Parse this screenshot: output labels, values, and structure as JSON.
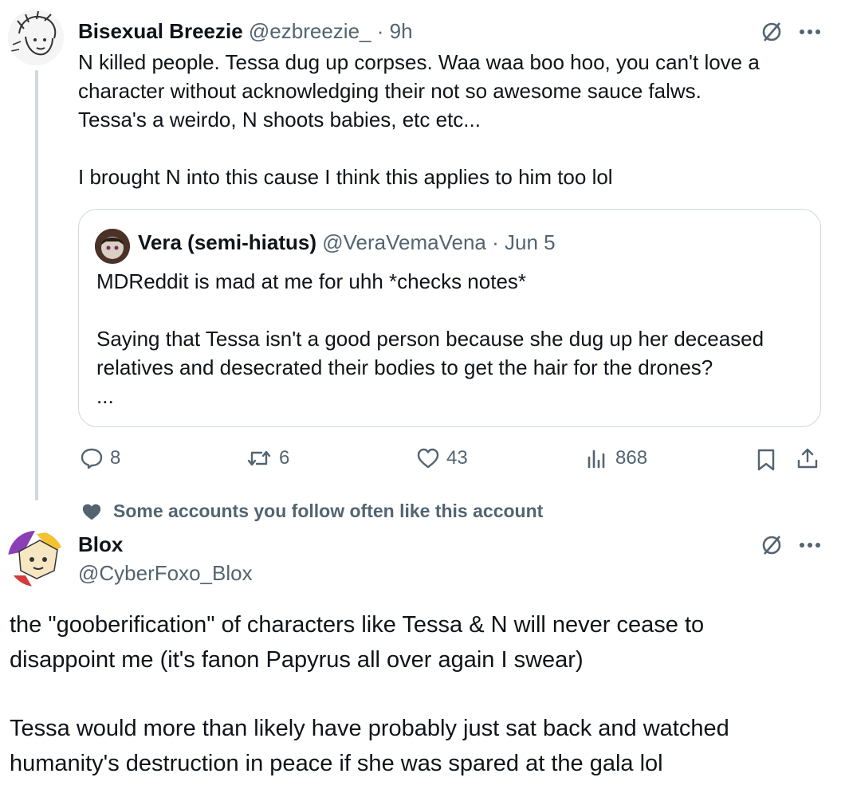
{
  "tweet1": {
    "name": "Bisexual Breezie",
    "handle": "@ezbreezie_",
    "time": "· 9h",
    "lines": [
      "N killed people. Tessa dug up corpses. Waa waa boo hoo, you can't love a",
      "character without acknowledging their not so awesome sauce falws.",
      "Tessa's a weirdo, N shoots babies, etc etc...",
      "",
      "I brought N into this cause I think this applies to him too lol"
    ],
    "quote": {
      "name": "Vera (semi-hiatus)",
      "handle": "@VeraVemaVena",
      "time": "· Jun 5",
      "lines": [
        "MDReddit is mad at me for uhh *checks notes*",
        "",
        "Saying that Tessa isn't a good person because she dug up her deceased",
        "relatives and desecrated their bodies to get the hair for the drones?",
        "..."
      ]
    },
    "actions": {
      "replies": "8",
      "reposts": "6",
      "likes": "43",
      "views": "868"
    },
    "more_icon": "more-icon",
    "grok_icon": "grok-icon"
  },
  "social_context": "Some accounts you follow often like this account",
  "tweet2": {
    "name": "Blox",
    "handle": "@CyberFoxo_Blox",
    "lines": [
      "the \"gooberification\" of characters like Tessa & N will never cease to",
      "disappoint me (it's fanon Papyrus all over again I swear)",
      "",
      "Tessa would more than likely have probably just sat back and watched",
      "humanity's destruction in peace if she was spared at the gala lol"
    ]
  },
  "colors": {
    "text": "#0f1419",
    "secondary": "#536471",
    "border": "#cfd9de"
  }
}
